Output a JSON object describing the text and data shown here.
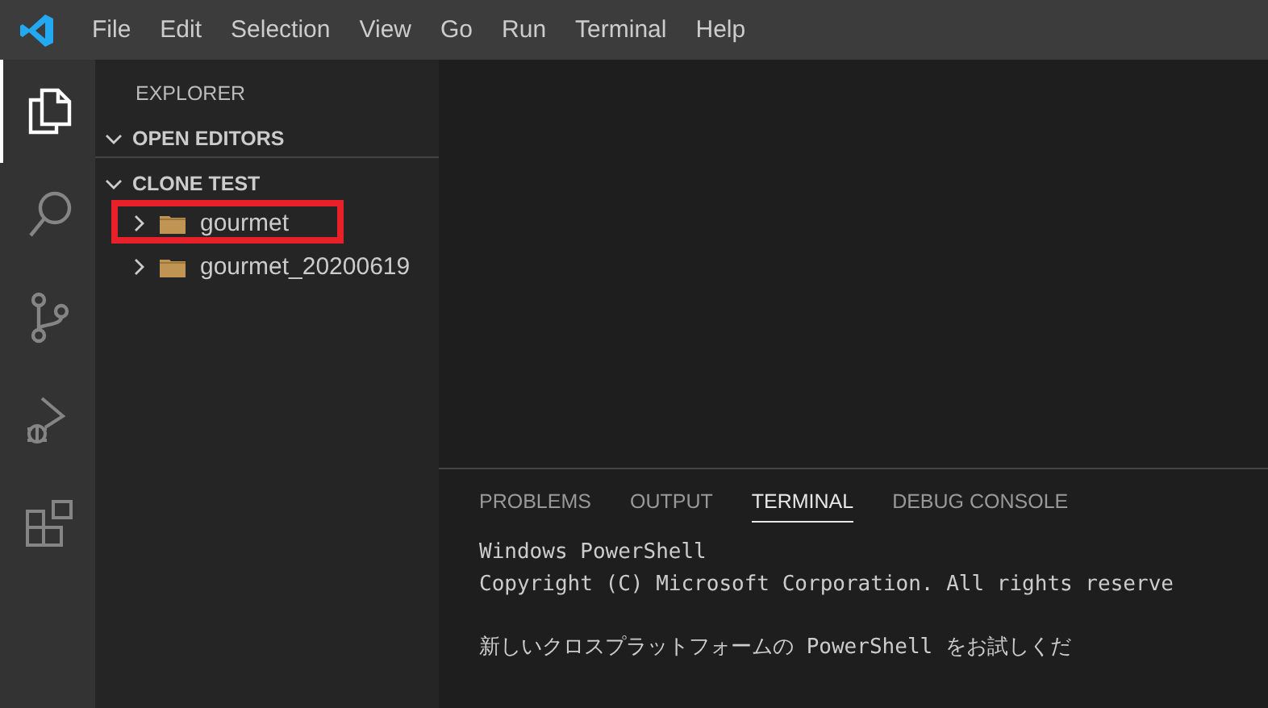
{
  "menu_bar": {
    "items": [
      "File",
      "Edit",
      "Selection",
      "View",
      "Go",
      "Run",
      "Terminal",
      "Help"
    ]
  },
  "activity_bar": {
    "items": [
      {
        "kind": "explorer",
        "selected": true
      },
      {
        "kind": "search",
        "selected": false
      },
      {
        "kind": "source-control",
        "selected": false
      },
      {
        "kind": "run-debug",
        "selected": false
      },
      {
        "kind": "extensions",
        "selected": false
      }
    ]
  },
  "sidebar": {
    "title": "EXPLORER",
    "sections": [
      {
        "label": "OPEN EDITORS",
        "expanded": true
      },
      {
        "label": "CLONE TEST",
        "expanded": true,
        "children": [
          {
            "label": "gourmet",
            "expanded": false,
            "highlighted": true
          },
          {
            "label": "gourmet_20200619",
            "expanded": false,
            "highlighted": false
          }
        ]
      }
    ]
  },
  "panel": {
    "tabs": [
      {
        "label": "PROBLEMS",
        "selected": false
      },
      {
        "label": "OUTPUT",
        "selected": false
      },
      {
        "label": "TERMINAL",
        "selected": true
      },
      {
        "label": "DEBUG CONSOLE",
        "selected": false
      }
    ],
    "terminal_paragraphs": [
      [
        "Windows PowerShell",
        "Copyright (C) Microsoft Corporation. All rights reserve"
      ],
      [
        "新しいクロスプラットフォームの PowerShell をお試しくだ"
      ]
    ]
  }
}
